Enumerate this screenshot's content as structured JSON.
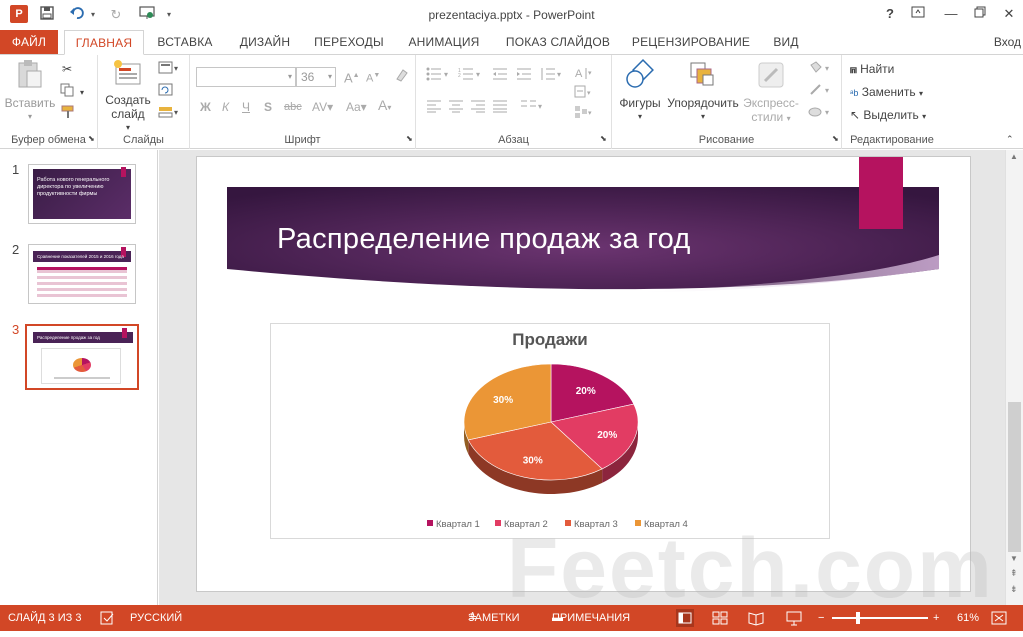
{
  "window": {
    "title": "prezentaciya.pptx - PowerPoint",
    "help": "?",
    "login": "Вход"
  },
  "tabs": [
    {
      "label": "ФАЙЛ"
    },
    {
      "label": "ГЛАВНАЯ"
    },
    {
      "label": "ВСТАВКА"
    },
    {
      "label": "ДИЗАЙН"
    },
    {
      "label": "ПЕРЕХОДЫ"
    },
    {
      "label": "АНИМАЦИЯ"
    },
    {
      "label": "ПОКАЗ СЛАЙДОВ"
    },
    {
      "label": "РЕЦЕНЗИРОВАНИЕ"
    },
    {
      "label": "ВИД"
    }
  ],
  "ribbon": {
    "clipboard": {
      "label": "Буфер обмена",
      "paste": "Вставить"
    },
    "slides": {
      "label": "Слайды",
      "new_slide_1": "Создать",
      "new_slide_2": "слайд"
    },
    "font": {
      "label": "Шрифт",
      "size": "36",
      "bold": "Ж",
      "italic": "К",
      "underline": "Ч",
      "strike": "S",
      "strike2": "abc"
    },
    "paragraph": {
      "label": "Абзац"
    },
    "drawing": {
      "label": "Рисование",
      "shapes": "Фигуры",
      "arrange": "Упорядочить",
      "styles_1": "Экспресс-",
      "styles_2": "стили"
    },
    "editing": {
      "label": "Редактирование",
      "find": "Найти",
      "replace": "Заменить",
      "select": "Выделить"
    }
  },
  "thumbnails": [
    {
      "num": "1",
      "text": "Работа нового генерального директора по увеличению продуктивности фирмы"
    },
    {
      "num": "2",
      "text": "Сравнение показателей 2015 и 2016 года"
    },
    {
      "num": "3",
      "text": "Распределение продаж за год"
    }
  ],
  "slide": {
    "title": "Распределение продаж за год"
  },
  "chart_data": {
    "type": "pie",
    "title": "Продажи",
    "categories": [
      "Квартал 1",
      "Квартал 2",
      "Квартал 3",
      "Квартал 4"
    ],
    "values": [
      20,
      20,
      30,
      30
    ],
    "labels": [
      "20%",
      "20%",
      "30%",
      "30%"
    ],
    "colors": [
      "#b5135f",
      "#e23c63",
      "#e35b3c",
      "#eb9636"
    ],
    "legend": "bottom"
  },
  "status": {
    "slide_count": "СЛАЙД 3 ИЗ 3",
    "language": "РУССКИЙ",
    "notes": "ЗАМЕТКИ",
    "comments": "ПРИМЕЧАНИЯ",
    "zoom": "61%"
  },
  "colors": {
    "accent": "#d24726",
    "slide_banner": "#4a2356",
    "tab_magenta": "#b5135f"
  },
  "watermark": "Feetch.com"
}
